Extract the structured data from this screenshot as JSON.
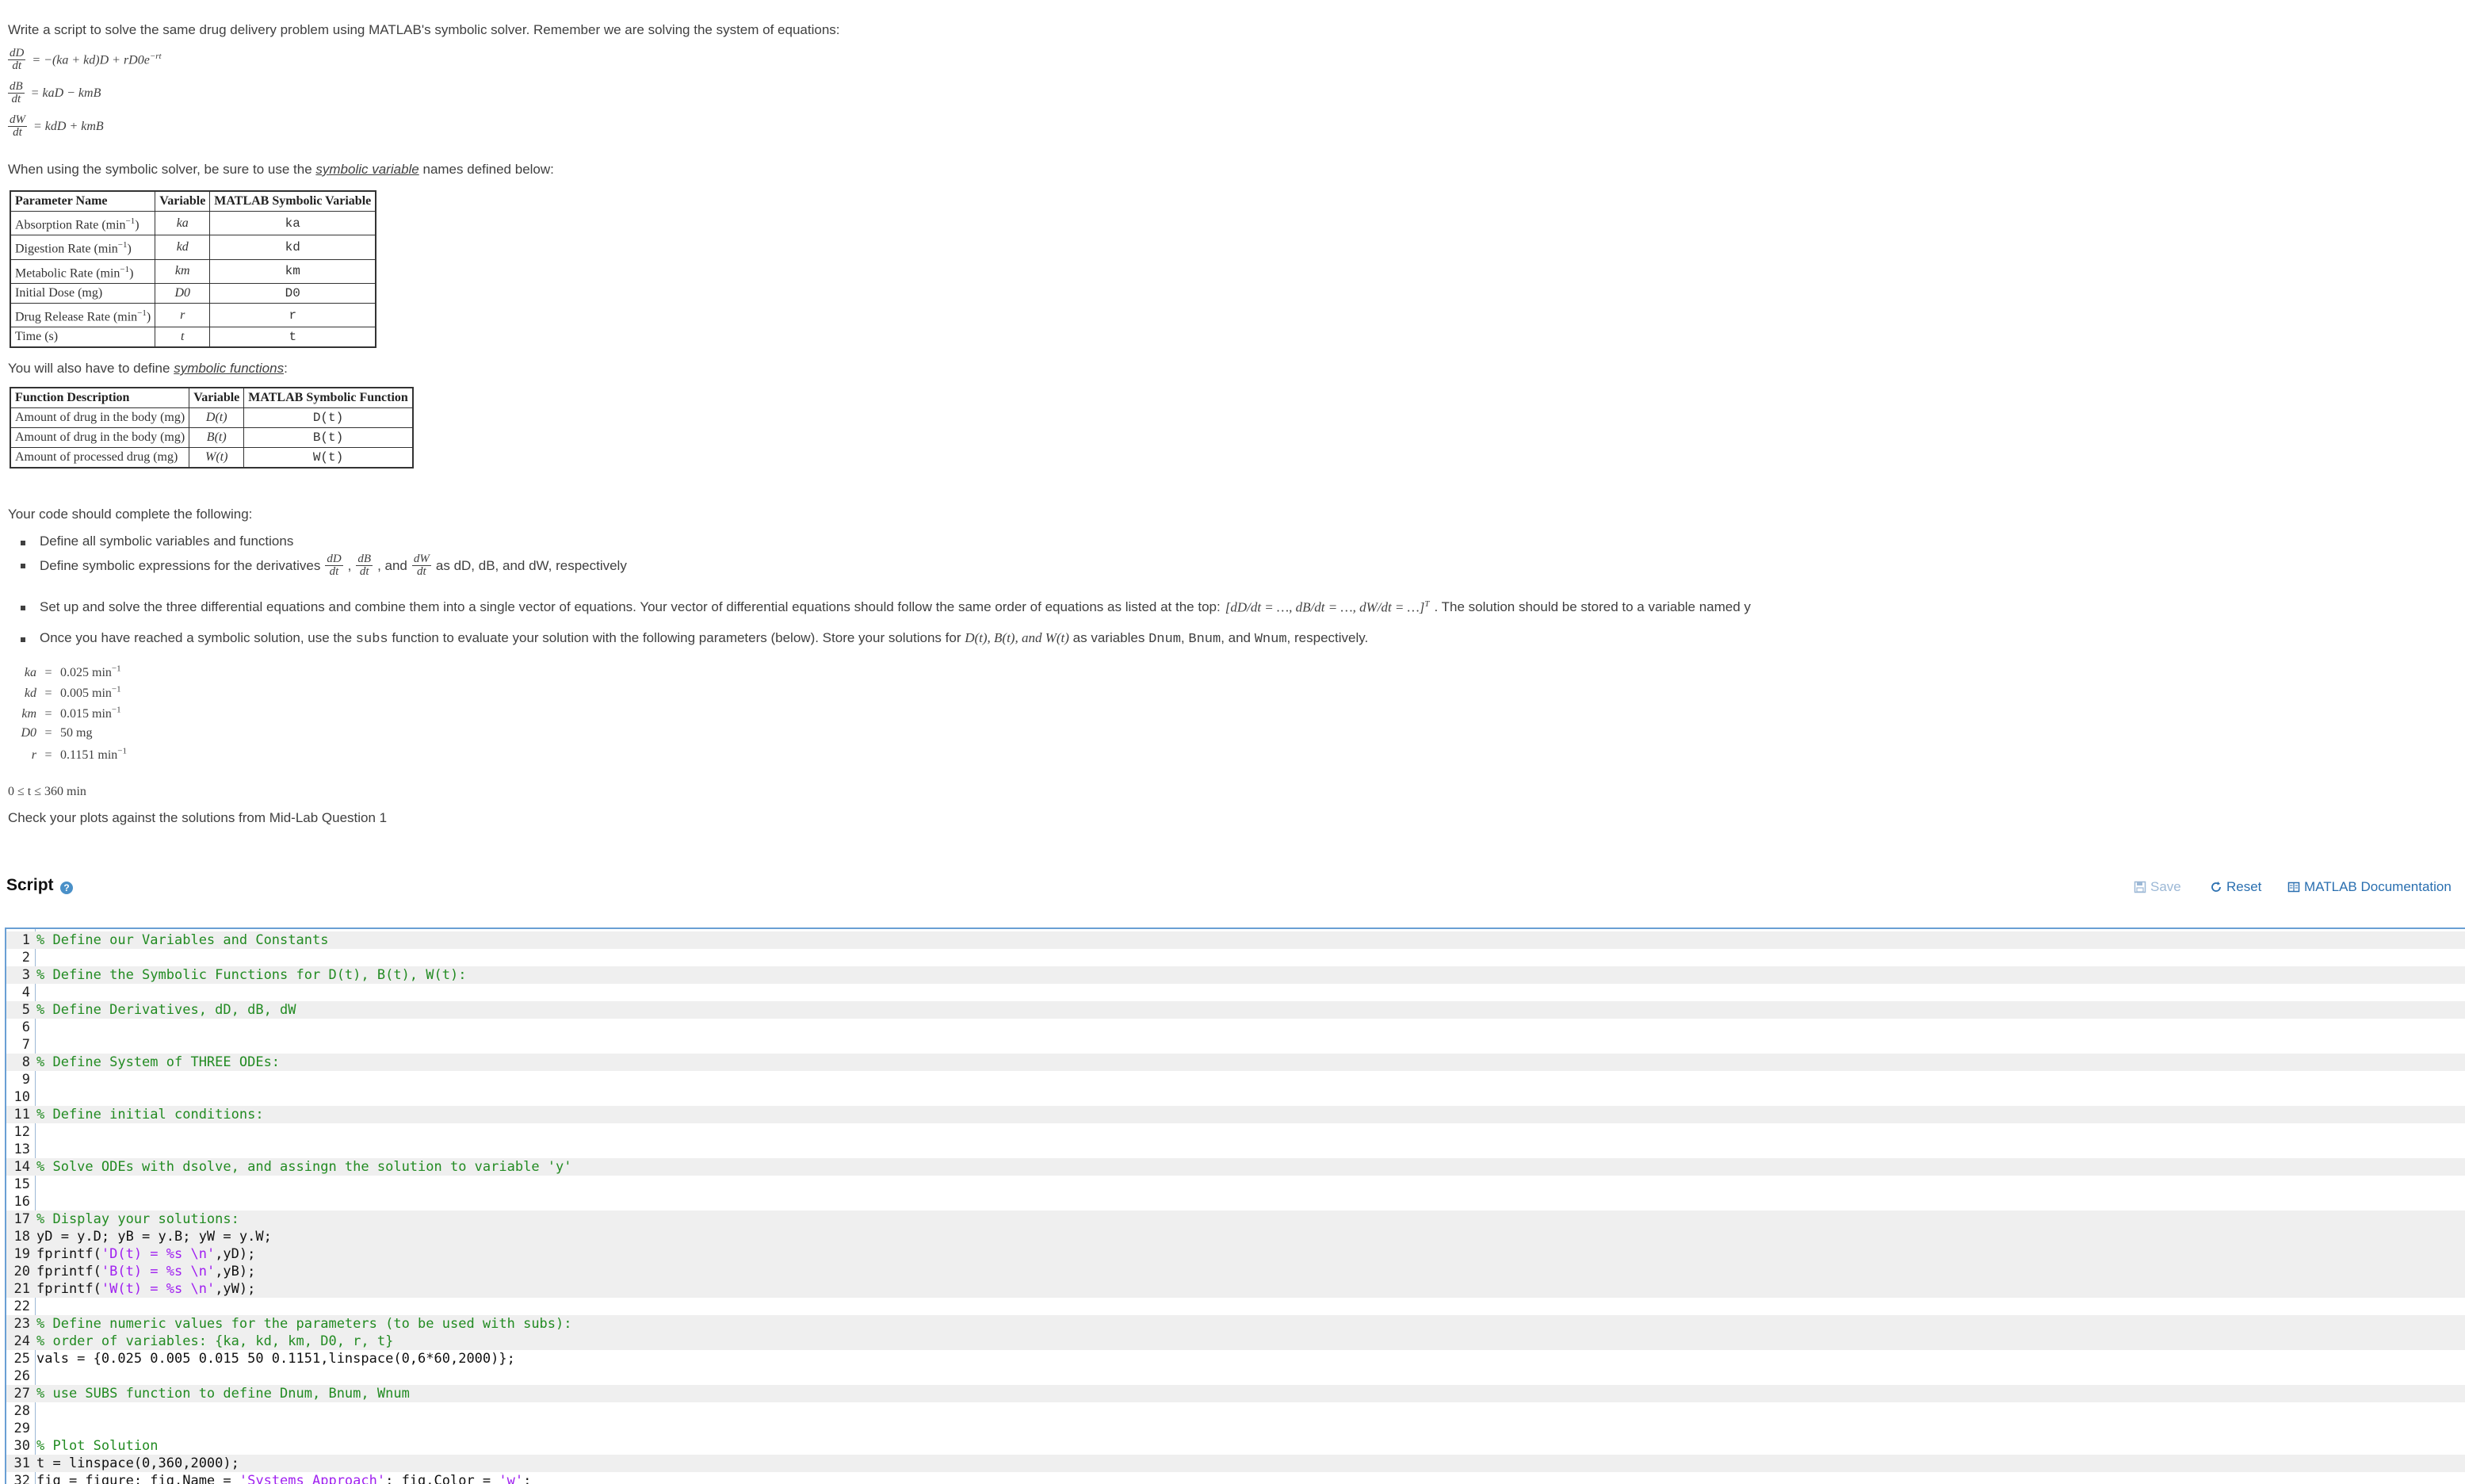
{
  "problem": {
    "intro": "Write a script to solve the same drug delivery problem using MATLAB's symbolic solver. Remember we are solving the system of equations:",
    "equations": [
      {
        "num": "dD",
        "den": "dt",
        "rhs": "= −(ka + kd)D + rD0e−rt"
      },
      {
        "num": "dB",
        "den": "dt",
        "rhs": "= kaD − kmB"
      },
      {
        "num": "dW",
        "den": "dt",
        "rhs": "= kdD + kmB"
      }
    ],
    "symvar_pre": "When using the symbolic solver, be sure to use the ",
    "symvar_link": "symbolic variable",
    "symvar_post": " names defined below:",
    "param_table": {
      "headers": [
        "Parameter Name",
        "Variable",
        "MATLAB Symbolic Variable"
      ],
      "rows": [
        [
          "Absorption Rate (min−1)",
          "ka",
          "ka"
        ],
        [
          "Digestion Rate (min−1)",
          "kd",
          "kd"
        ],
        [
          "Metabolic Rate (min−1)",
          "km",
          "km"
        ],
        [
          "Initial Dose (mg)",
          "D0",
          "D0"
        ],
        [
          "Drug Release Rate (min−1)",
          "r",
          "r"
        ],
        [
          "Time (s)",
          "t",
          "t"
        ]
      ]
    },
    "symfun_pre": "You will also have to define ",
    "symfun_link": "symbolic functions",
    "symfun_post": ":",
    "func_table": {
      "headers": [
        "Function Description",
        "Variable",
        "MATLAB Symbolic Function"
      ],
      "rows": [
        [
          "Amount of drug in the body (mg)",
          "D(t)",
          "D(t)"
        ],
        [
          "Amount of drug in the body (mg)",
          "B(t)",
          "B(t)"
        ],
        [
          "Amount of processed drug (mg)",
          "W(t)",
          "W(t)"
        ]
      ]
    },
    "complete_intro": "Your code should complete the following:",
    "tasks": {
      "t1": "Define all symbolic variables and functions",
      "t2_pre": "Define symbolic expressions for the derivatives",
      "t2_and": ", and",
      "t2_post": "as dD, dB, and dW, respectively",
      "t3_pre": "Set up and solve the three differential equations and combine them into a single vector of equations. Your vector  of  differential equations should follow the same order of equations as listed at the top:",
      "t3_vec": "[dD/dt = …, dB/dt = …, dW/dt = …]T",
      "t3_post": ". The solution should be stored to a variable named y",
      "t4_a": "Once you have reached a symbolic solution, use the ",
      "t4_subs": "subs",
      "t4_b": " function to evaluate your solution with the following parameters (below). Store your solutions for ",
      "t4_funcs": "D(t), B(t), and W(t)",
      "t4_c": " as variables ",
      "t4_d": "Dnum",
      "t4_e": ", ",
      "t4_f": "Bnum",
      "t4_g": ", and ",
      "t4_h": "Wnum",
      "t4_i": ", respectively."
    },
    "params": [
      {
        "lhs": "ka",
        "val": "0.025  min−1"
      },
      {
        "lhs": "kd",
        "val": "0.005  min−1"
      },
      {
        "lhs": "km",
        "val": "0.015  min−1"
      },
      {
        "lhs": "D0",
        "val": "50  mg"
      },
      {
        "lhs": "r",
        "val": "0.1151  min−1"
      }
    ],
    "time_range": "0 ≤ t ≤ 360  min",
    "check": "Check your plots against the solutions from Mid-Lab Question 1"
  },
  "script": {
    "title": "Script",
    "help_icon": "?",
    "save_label": "Save",
    "reset_label": "Reset",
    "doc_label": "MATLAB Documentation",
    "lines": [
      {
        "n": "1",
        "t": "% Define our Variables and Constants"
      },
      {
        "n": "2",
        "t": ""
      },
      {
        "n": "3",
        "t": "% Define the Symbolic Functions for D(t), B(t), W(t):"
      },
      {
        "n": "4",
        "t": ""
      },
      {
        "n": "5",
        "t": "% Define Derivatives, dD, dB, dW"
      },
      {
        "n": "6",
        "t": ""
      },
      {
        "n": "7",
        "t": ""
      },
      {
        "n": "8",
        "t": "% Define System of THREE ODEs:"
      },
      {
        "n": "9",
        "t": ""
      },
      {
        "n": "10",
        "t": ""
      },
      {
        "n": "11",
        "t": "% Define initial conditions:"
      },
      {
        "n": "12",
        "t": ""
      },
      {
        "n": "13",
        "t": ""
      },
      {
        "n": "14",
        "t": "% Solve ODEs with dsolve, and assingn the solution to variable 'y'"
      },
      {
        "n": "15",
        "t": ""
      },
      {
        "n": "16",
        "t": ""
      },
      {
        "n": "17",
        "t": "% Display your solutions:"
      },
      {
        "n": "18",
        "t": "yD = y.D; yB = y.B; yW = y.W;"
      },
      {
        "n": "19",
        "t": "fprintf('D(t) = %s \\n',yD);"
      },
      {
        "n": "20",
        "t": "fprintf('B(t) = %s \\n',yB);"
      },
      {
        "n": "21",
        "t": "fprintf('W(t) = %s \\n',yW);"
      },
      {
        "n": "22",
        "t": ""
      },
      {
        "n": "23",
        "t": "% Define numeric values for the parameters (to be used with subs):"
      },
      {
        "n": "24",
        "t": "% order of variables: {ka, kd, km, D0, r, t}"
      },
      {
        "n": "25",
        "t": "vals = {0.025 0.005 0.015 50 0.1151,linspace(0,6*60,2000)};"
      },
      {
        "n": "26",
        "t": ""
      },
      {
        "n": "27",
        "t": "% use SUBS function to define Dnum, Bnum, Wnum"
      },
      {
        "n": "28",
        "t": ""
      },
      {
        "n": "29",
        "t": ""
      },
      {
        "n": "30",
        "t": "% Plot Solution"
      },
      {
        "n": "31",
        "t": "t = linspace(0,360,2000);"
      },
      {
        "n": "32",
        "t": "fig = figure; fig.Name = 'Systems Approach'; fig.Color = 'w';"
      }
    ]
  }
}
